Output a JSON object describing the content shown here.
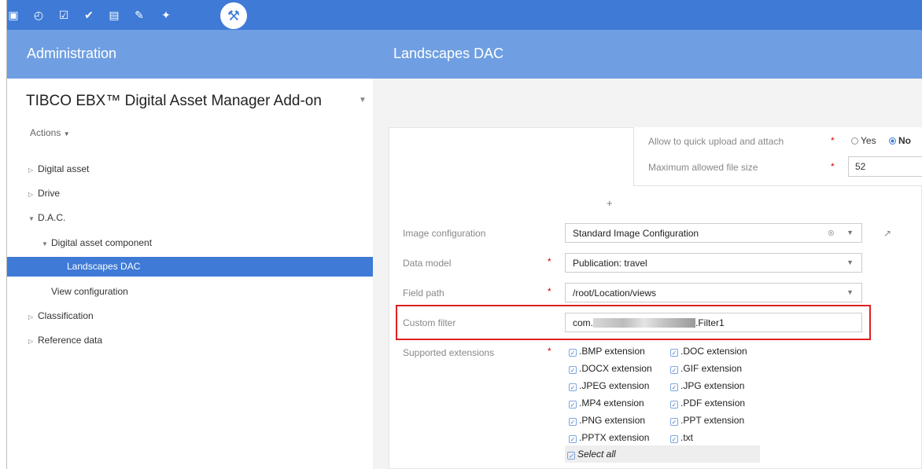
{
  "toolbar": {
    "icons": [
      "database-icon",
      "clock-icon",
      "checkbox-icon",
      "check-circle-icon",
      "database-edit-icon",
      "task-edit-icon",
      "plug-icon",
      "wrench-icon"
    ],
    "active_icon": "wrench-icon",
    "accent_color": "#3e7ad6"
  },
  "header": {
    "left_title": "Administration",
    "right_title": "Landscapes DAC"
  },
  "sidebar": {
    "app_title": "TIBCO EBX™ Digital Asset Manager Add-on",
    "actions_label": "Actions",
    "tree": {
      "digital_asset": "Digital asset",
      "drive": "Drive",
      "dac": "D.A.C.",
      "digital_asset_component": "Digital asset component",
      "landscapes_dac": "Landscapes DAC",
      "view_configuration": "View configuration",
      "classification": "Classification",
      "reference_data": "Reference data"
    }
  },
  "form": {
    "quick_upload": {
      "label": "Allow to quick upload and attach",
      "required": "*",
      "yes": "Yes",
      "no": "No",
      "selected": "No"
    },
    "max_file_size": {
      "label": "Maximum allowed file size",
      "required": "*",
      "value": "52"
    },
    "add_symbol": "+",
    "image_configuration": {
      "label": "Image configuration",
      "value": "Standard Image Configuration"
    },
    "data_model": {
      "label": "Data model",
      "required": "*",
      "value": "Publication: travel"
    },
    "field_path": {
      "label": "Field path",
      "required": "*",
      "value": "/root/Location/views"
    },
    "custom_filter": {
      "label": "Custom filter",
      "value_prefix": "com.",
      "value_suffix": ".Filter1"
    },
    "supported_extensions": {
      "label": "Supported extensions",
      "required": "*",
      "items": [
        ".BMP extension",
        ".DOC extension",
        ".DOCX extension",
        ".GIF extension",
        ".JPEG extension",
        ".JPG extension",
        ".MP4 extension",
        ".PDF extension",
        ".PNG extension",
        ".PPT extension",
        ".PPTX extension",
        ".txt"
      ],
      "select_all": "Select all"
    }
  }
}
